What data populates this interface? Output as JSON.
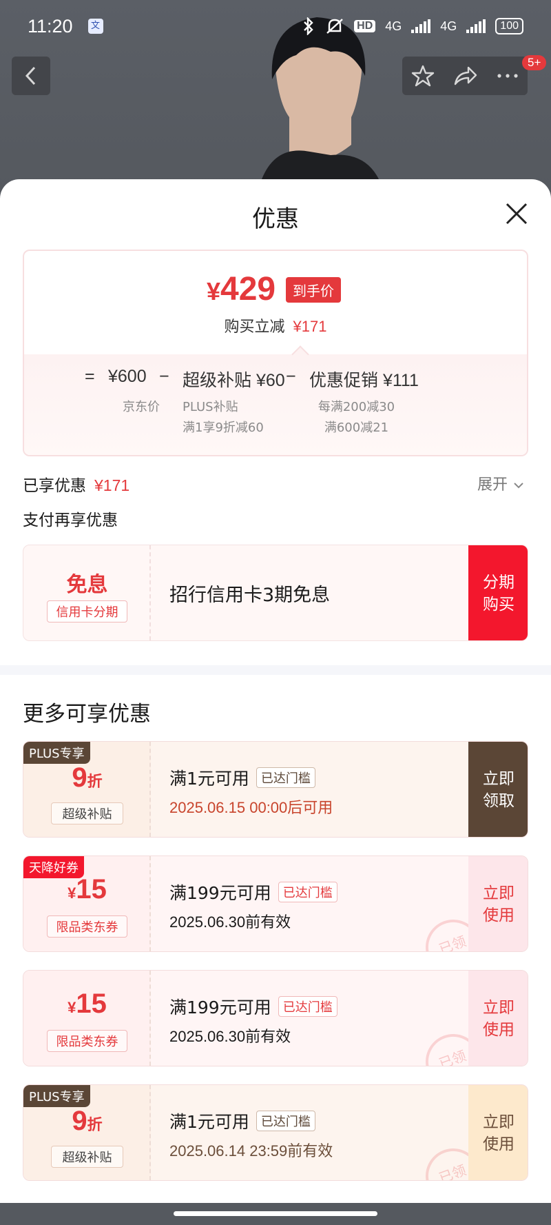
{
  "status_bar": {
    "time": "11:20",
    "app_icon": "文",
    "network_1": "4G",
    "network_2": "4G",
    "hd_label": "HD",
    "battery": "100"
  },
  "header": {
    "badge": "5+"
  },
  "sheet": {
    "title": "优惠",
    "price_card": {
      "currency": "¥",
      "final_price": "429",
      "final_tag": "到手价",
      "reduce_label": "购买立减",
      "reduce_value": "¥171",
      "eq": "=",
      "jd_price": "¥600",
      "minus1": "−",
      "subsidy": "超级补贴 ¥60",
      "minus2": "−",
      "promo": "优惠促销 ¥111",
      "jd_price_label": "京东价",
      "subsidy_note1": "PLUS补贴",
      "subsidy_note2": "满1享9折减60",
      "promo_note1": "每满200减30",
      "promo_note2": "满600减21"
    },
    "enjoyed_label": "已享优惠",
    "enjoyed_value": "¥171",
    "expand_label": "展开",
    "pay_title": "支付再享优惠",
    "installment": {
      "big": "免息",
      "small": "信用卡分期",
      "text": "招行信用卡3期免息",
      "btn_line1": "分期",
      "btn_line2": "购买"
    },
    "more_title": "更多可享优惠",
    "coupons": [
      {
        "tag": "PLUS专享",
        "value": "9",
        "unit": "折",
        "desc": "超级补贴",
        "cond": "满1元可用",
        "pill": "已达门槛",
        "date": "2025.06.15 00:00后可用",
        "btn1": "立即",
        "btn2": "领取"
      },
      {
        "tag": "天降好券",
        "prefix": "¥",
        "value": "15",
        "desc": "限品类东券",
        "cond": "满199元可用",
        "pill": "已达门槛",
        "date": "2025.06.30前有效",
        "btn1": "立即",
        "btn2": "使用",
        "stamp": "已领"
      },
      {
        "prefix": "¥",
        "value": "15",
        "desc": "限品类东券",
        "cond": "满199元可用",
        "pill": "已达门槛",
        "date": "2025.06.30前有效",
        "btn1": "立即",
        "btn2": "使用",
        "stamp": "已领"
      },
      {
        "tag": "PLUS专享",
        "value": "9",
        "unit": "折",
        "desc": "超级补贴",
        "cond": "满1元可用",
        "pill": "已达门槛",
        "date": "2025.06.14 23:59前有效",
        "btn1": "立即",
        "btn2": "使用",
        "stamp": "已领"
      }
    ]
  },
  "colors": {
    "accent_red": "#e4393c",
    "plus_brown": "#5b4636",
    "installment_red": "#f3172d"
  },
  "icons": [
    "back-arrow-icon",
    "star-icon",
    "share-icon",
    "more-icon",
    "close-icon",
    "chevron-down-icon",
    "bluetooth-icon",
    "mute-icon",
    "signal-icon",
    "battery-icon"
  ]
}
